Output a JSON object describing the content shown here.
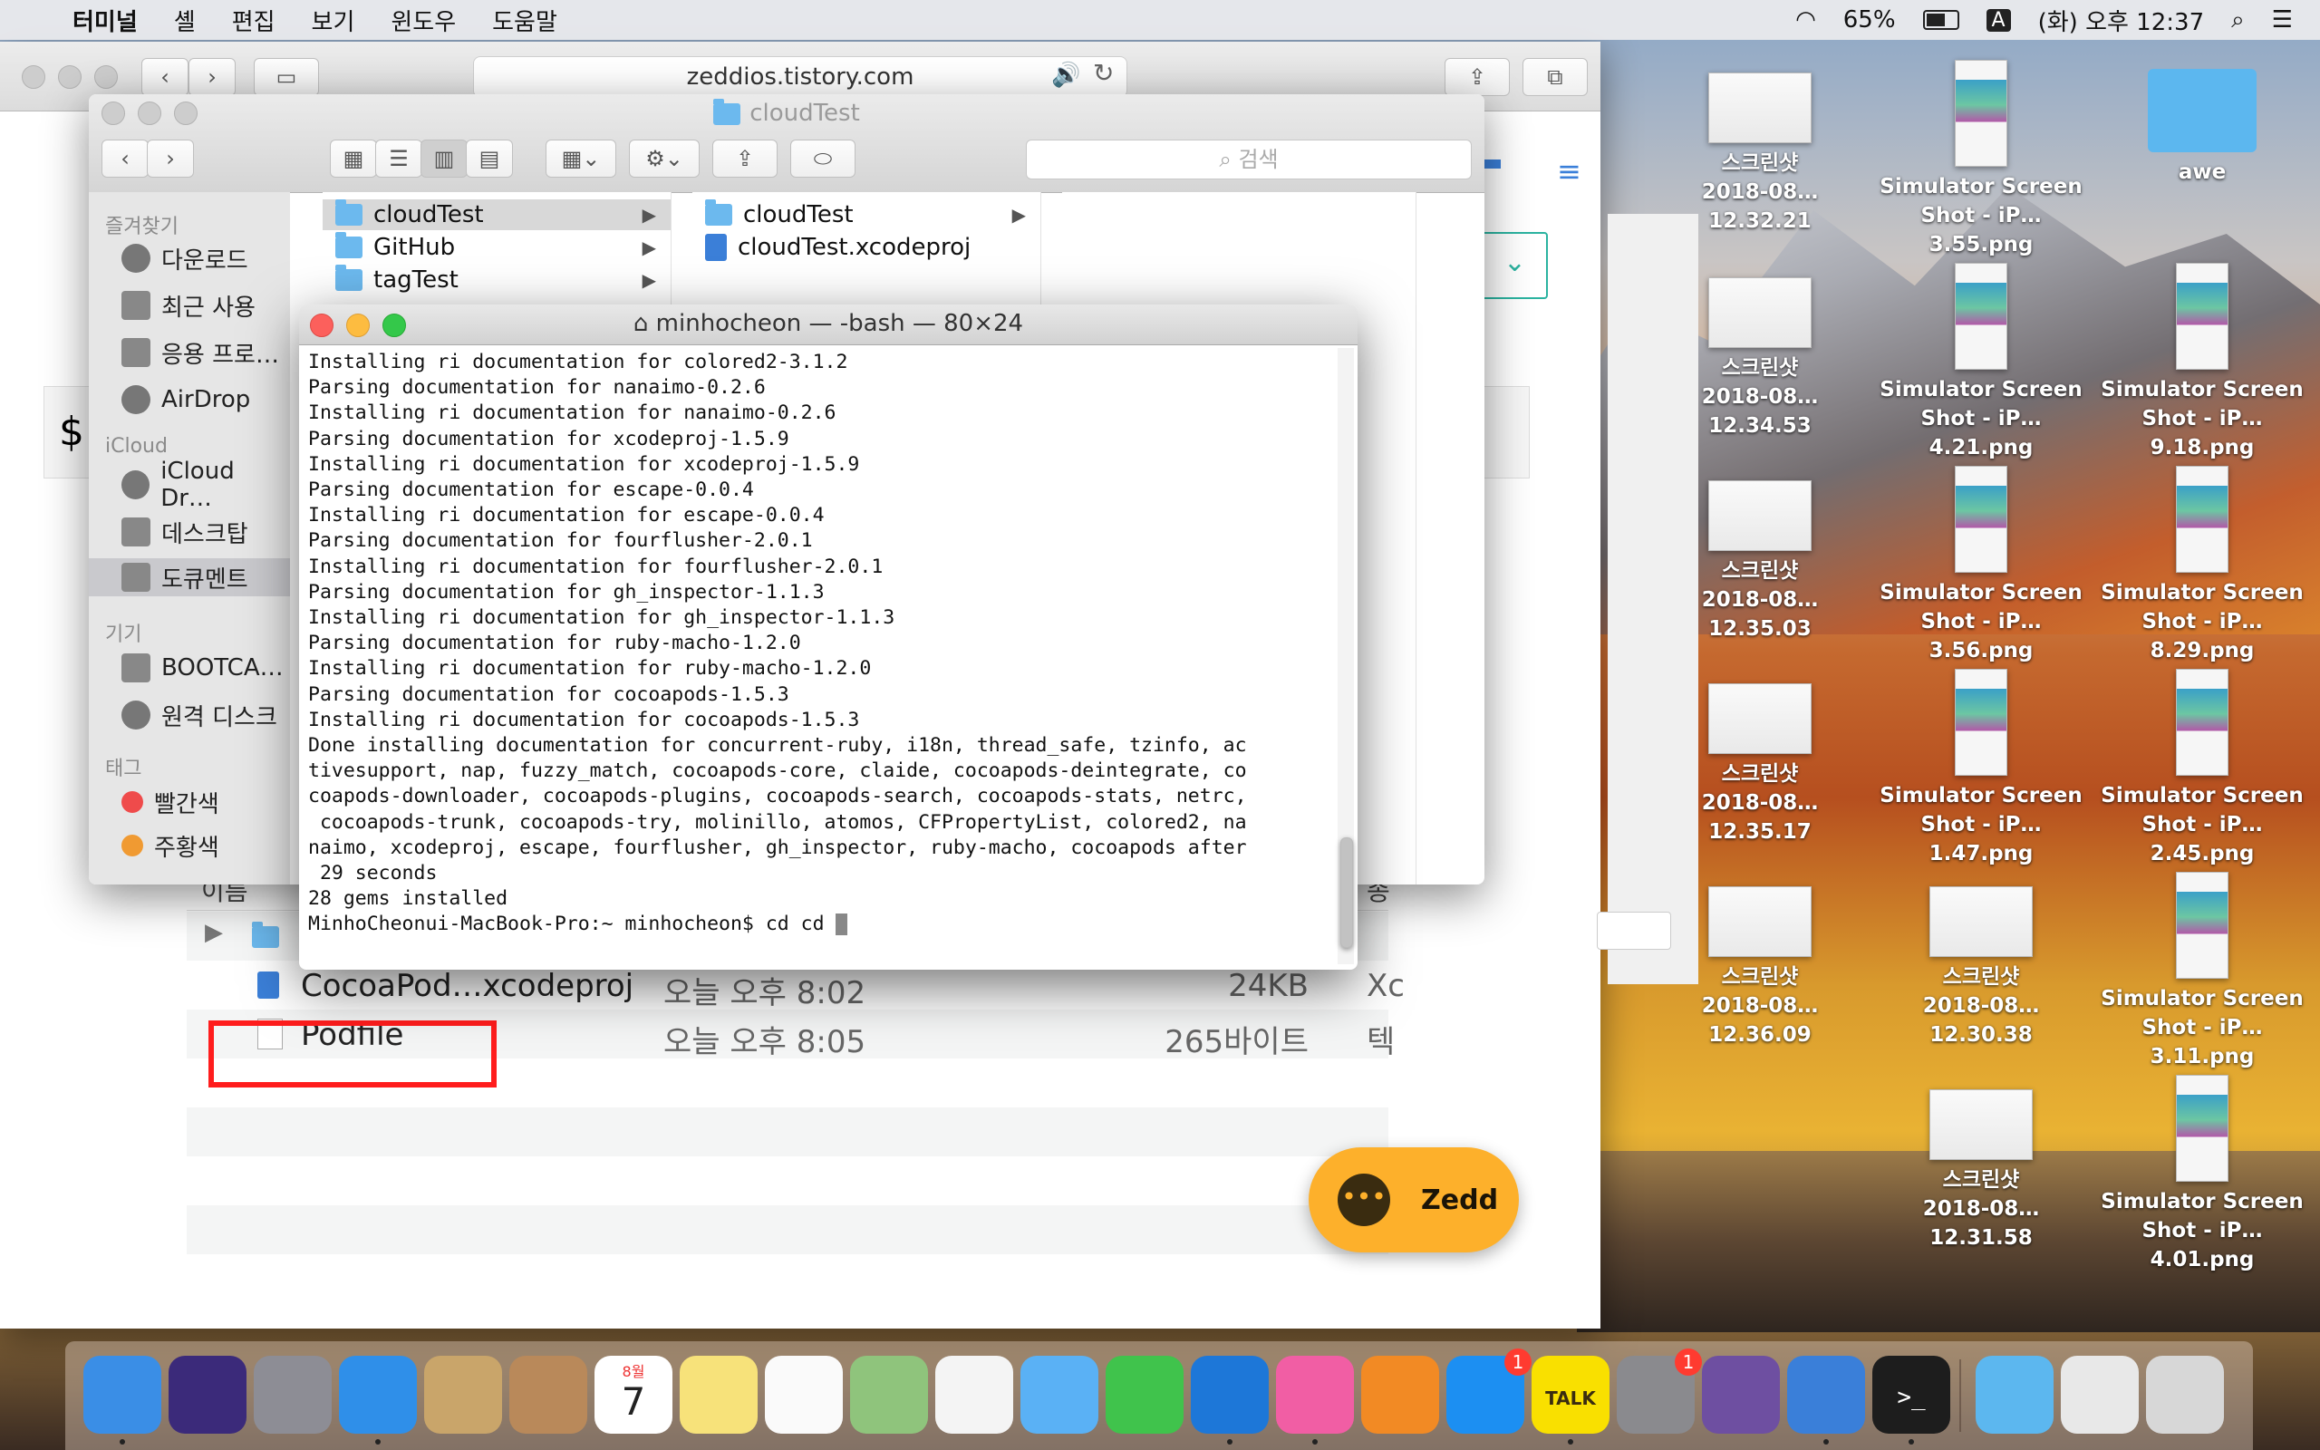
{
  "menubar": {
    "apple": "",
    "app": "터미널",
    "items": [
      "셸",
      "편집",
      "보기",
      "윈도우",
      "도움말"
    ],
    "battery": "65%",
    "input": "A",
    "clock": "(화) 오후 12:37"
  },
  "safari": {
    "url": "zeddios.tistory.com"
  },
  "finder": {
    "title": "cloudTest",
    "search_placeholder": "검색",
    "sidebar": {
      "favorites_title": "즐겨찾기",
      "favorites": [
        "다운로드",
        "최근 사용",
        "응용 프로…",
        "AirDrop"
      ],
      "icloud_title": "iCloud",
      "icloud": [
        "iCloud Dr…",
        "데스크탑",
        "도큐멘트"
      ],
      "devices_title": "기기",
      "devices": [
        "BOOTCA…",
        "원격 디스크"
      ],
      "tags_title": "태그",
      "tags": [
        "빨간색",
        "주황색"
      ]
    },
    "col1": [
      "cloudTest",
      "GitHub",
      "tagTest"
    ],
    "col2": [
      "cloudTest",
      "cloudTest.xcodeproj"
    ]
  },
  "list": {
    "header_name": "이름",
    "header_kind": "종",
    "rows": [
      {
        "name": "CocoaPod…xcodeproj",
        "date": "오늘 오후 8:02",
        "size": "24KB",
        "kind": "Xc"
      },
      {
        "name": "Podfile",
        "date": "오늘 오후 8:05",
        "size": "265바이트",
        "kind": "텍"
      }
    ]
  },
  "terminal": {
    "title": "minhocheon — -bash — 80×24",
    "lines": [
      "Installing ri documentation for colored2-3.1.2",
      "Parsing documentation for nanaimo-0.2.6",
      "Installing ri documentation for nanaimo-0.2.6",
      "Parsing documentation for xcodeproj-1.5.9",
      "Installing ri documentation for xcodeproj-1.5.9",
      "Parsing documentation for escape-0.0.4",
      "Installing ri documentation for escape-0.0.4",
      "Parsing documentation for fourflusher-2.0.1",
      "Installing ri documentation for fourflusher-2.0.1",
      "Parsing documentation for gh_inspector-1.1.3",
      "Installing ri documentation for gh_inspector-1.1.3",
      "Parsing documentation for ruby-macho-1.2.0",
      "Installing ri documentation for ruby-macho-1.2.0",
      "Parsing documentation for cocoapods-1.5.3",
      "Installing ri documentation for cocoapods-1.5.3",
      "Done installing documentation for concurrent-ruby, i18n, thread_safe, tzinfo, ac",
      "tivesupport, nap, fuzzy_match, cocoapods-core, claide, cocoapods-deintegrate, co",
      "coapods-downloader, cocoapods-plugins, cocoapods-search, cocoapods-stats, netrc,",
      " cocoapods-trunk, cocoapods-try, molinillo, atomos, CFPropertyList, colored2, na",
      "naimo, xcodeproj, escape, fourflusher, gh_inspector, ruby-macho, cocoapods after",
      " 29 seconds",
      "28 gems installed",
      "MinhoCheonui-MacBook-Pro:~ minhocheon$ cd cd "
    ]
  },
  "desktop": [
    {
      "l1": "스크린샷",
      "l2": "2018-08…12.32.21",
      "kind": "shot"
    },
    {
      "l1": "Simulator Screen",
      "l2": "Shot - iP…3.55.png",
      "kind": "phone"
    },
    {
      "l1": "awe",
      "l2": "",
      "kind": "folder"
    },
    {
      "l1": "스크린샷",
      "l2": "2018-08…12.34.53",
      "kind": "shot"
    },
    {
      "l1": "Simulator Screen",
      "l2": "Shot - iP…4.21.png",
      "kind": "phone"
    },
    {
      "l1": "Simulator Screen",
      "l2": "Shot - iP…9.18.png",
      "kind": "phone"
    },
    {
      "l1": "스크린샷",
      "l2": "2018-08…12.35.03",
      "kind": "shot"
    },
    {
      "l1": "Simulator Screen",
      "l2": "Shot - iP…3.56.png",
      "kind": "phone"
    },
    {
      "l1": "Simulator Screen",
      "l2": "Shot - iP…8.29.png",
      "kind": "phone"
    },
    {
      "l1": "스크린샷",
      "l2": "2018-08…12.35.17",
      "kind": "shot"
    },
    {
      "l1": "Simulator Screen",
      "l2": "Shot - iP…1.47.png",
      "kind": "phone"
    },
    {
      "l1": "Simulator Screen",
      "l2": "Shot - iP…2.45.png",
      "kind": "phone"
    },
    {
      "l1": "스크린샷",
      "l2": "2018-08…12.36.09",
      "kind": "shot"
    },
    {
      "l1": "스크린샷",
      "l2": "2018-08…12.30.38",
      "kind": "shot"
    },
    {
      "l1": "Simulator Screen",
      "l2": "Shot - iP…3.11.png",
      "kind": "phone"
    },
    {
      "l1": "스크린샷",
      "l2": "2018-08…12.31.58",
      "kind": "shot"
    },
    {
      "l1": "Simulator Screen",
      "l2": "Shot - iP…4.01.png",
      "kind": "phone"
    }
  ],
  "zedd": {
    "name": "Zedd",
    "bubble": "•••"
  },
  "dock": {
    "apps": [
      {
        "name": "finder-icon",
        "color": "#3a8ee6"
      },
      {
        "name": "siri-icon",
        "color": "#3b2a7a"
      },
      {
        "name": "launchpad-icon",
        "color": "#8d8d95"
      },
      {
        "name": "safari-icon",
        "color": "#2f8fe9"
      },
      {
        "name": "mail-icon",
        "color": "#c9a56a"
      },
      {
        "name": "contacts-icon",
        "color": "#b9895a"
      },
      {
        "name": "calendar-icon",
        "color": "#ffffff"
      },
      {
        "name": "notes-icon",
        "color": "#f7e27a"
      },
      {
        "name": "reminders-icon",
        "color": "#fafafa"
      },
      {
        "name": "maps-icon",
        "color": "#8fc47c"
      },
      {
        "name": "photos-icon",
        "color": "#f4f4f4"
      },
      {
        "name": "messages-icon",
        "color": "#5ab1f5"
      },
      {
        "name": "facetime-icon",
        "color": "#40c34c"
      },
      {
        "name": "xcode-icon",
        "color": "#1d77d8"
      },
      {
        "name": "itunes-icon",
        "color": "#f15ea4"
      },
      {
        "name": "ibooks-icon",
        "color": "#f28a24"
      },
      {
        "name": "appstore-icon",
        "color": "#1c8ff2"
      },
      {
        "name": "kakaotalk-icon",
        "color": "#f9e000"
      },
      {
        "name": "system-preferences-icon",
        "color": "#8a8a8e"
      },
      {
        "name": "github-icon",
        "color": "#6e4fa1"
      },
      {
        "name": "simulator-icon",
        "color": "#3a7fd9"
      },
      {
        "name": "terminal-icon",
        "color": "#1d1d1d"
      },
      {
        "name": "downloads-folder-icon",
        "color": "#5cb7ef"
      },
      {
        "name": "screenshot-stack-icon",
        "color": "#e8e8e8"
      },
      {
        "name": "trash-icon",
        "color": "#d7d7d7"
      }
    ],
    "calendar_month": "8월",
    "calendar_day": "7",
    "kakao_label": "TALK",
    "appstore_badge": "1",
    "prefs_badge": "1",
    "terminal_glyph": ">_"
  }
}
